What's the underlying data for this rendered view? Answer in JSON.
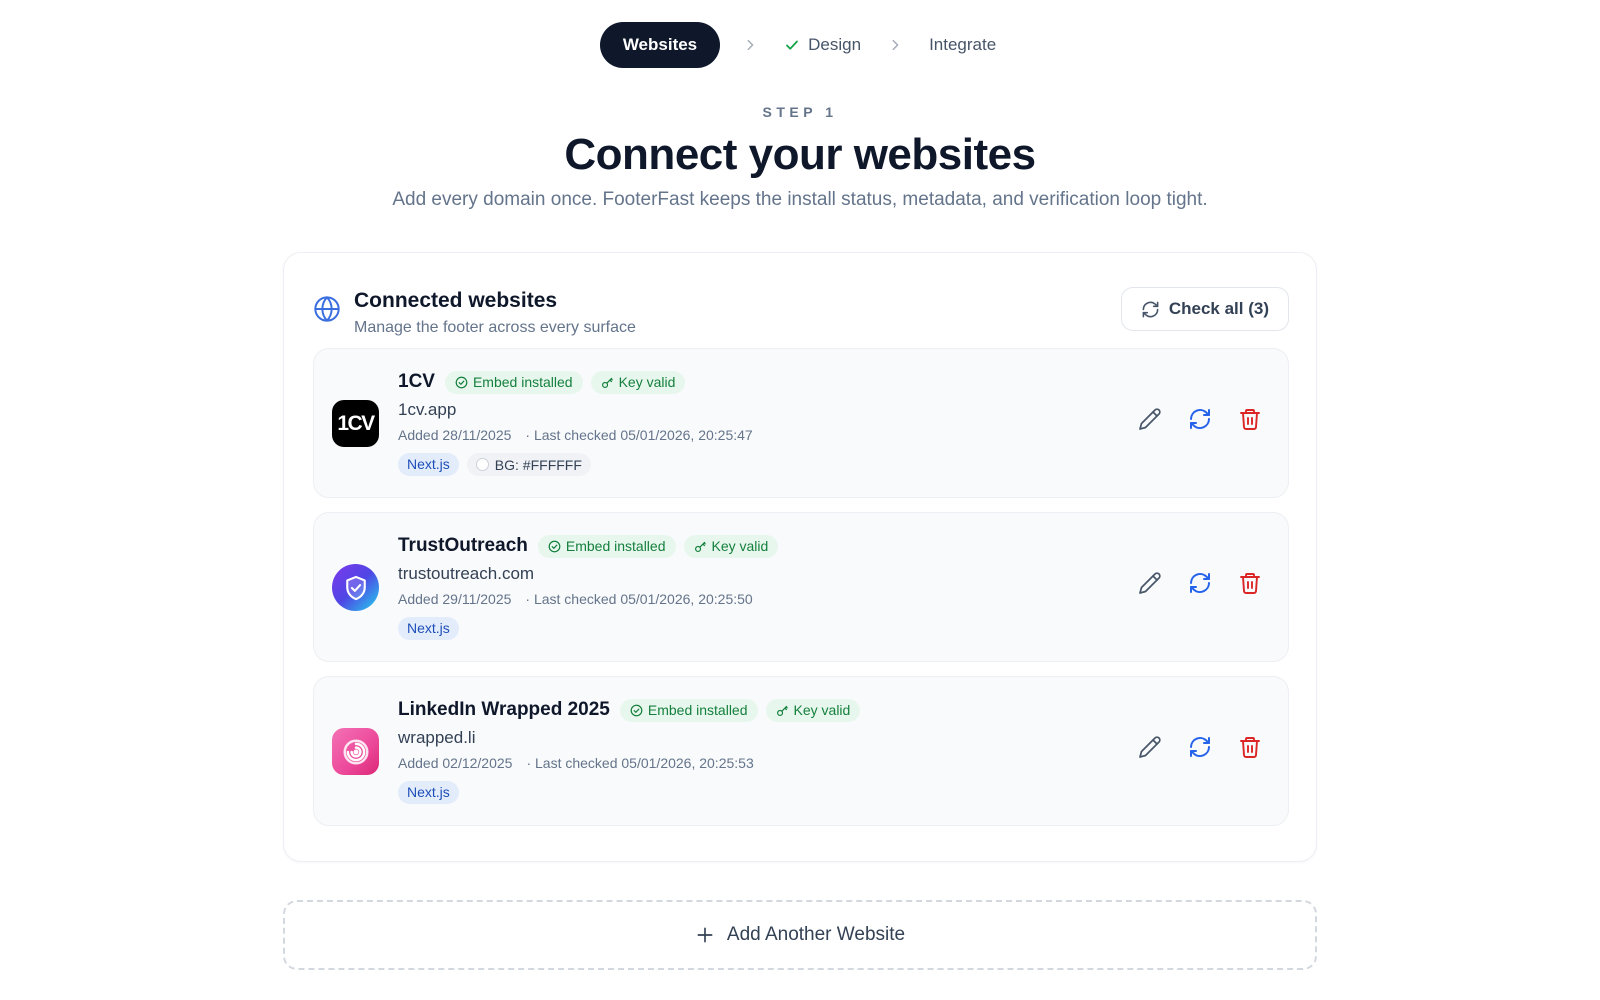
{
  "stepper": {
    "steps": [
      {
        "label": "Websites",
        "state": "active"
      },
      {
        "label": "Design",
        "state": "done"
      },
      {
        "label": "Integrate",
        "state": "pending"
      }
    ]
  },
  "hero": {
    "eyebrow": "STEP 1",
    "title": "Connect your websites",
    "subtitle": "Add every domain once. FooterFast keeps the install status, metadata, and verification loop tight."
  },
  "panel": {
    "icon": "globe-icon",
    "title": "Connected websites",
    "subtitle": "Manage the footer across every surface",
    "check_all_label": "Check all (3)"
  },
  "websites": [
    {
      "name": "1CV",
      "logo_text": "1CV",
      "embed_badge": "Embed installed",
      "key_badge": "Key valid",
      "domain": "1cv.app",
      "added": "Added 28/11/2025",
      "last_checked": "· Last checked 05/01/2026, 20:25:47",
      "framework": "Next.js",
      "bg_label": "BG: #FFFFFF"
    },
    {
      "name": "TrustOutreach",
      "logo_text": "",
      "embed_badge": "Embed installed",
      "key_badge": "Key valid",
      "domain": "trustoutreach.com",
      "added": "Added 29/11/2025",
      "last_checked": "· Last checked 05/01/2026, 20:25:50",
      "framework": "Next.js"
    },
    {
      "name": "LinkedIn Wrapped 2025",
      "logo_text": "",
      "embed_badge": "Embed installed",
      "key_badge": "Key valid",
      "domain": "wrapped.li",
      "added": "Added 02/12/2025",
      "last_checked": "· Last checked 05/01/2026, 20:25:53",
      "framework": "Next.js"
    }
  ],
  "add_button_label": "Add Another Website",
  "colors": {
    "primary_dark": "#0f172a",
    "accent_blue": "#3b6fe0",
    "success_green": "#15803d",
    "danger_red": "#dc2626"
  }
}
